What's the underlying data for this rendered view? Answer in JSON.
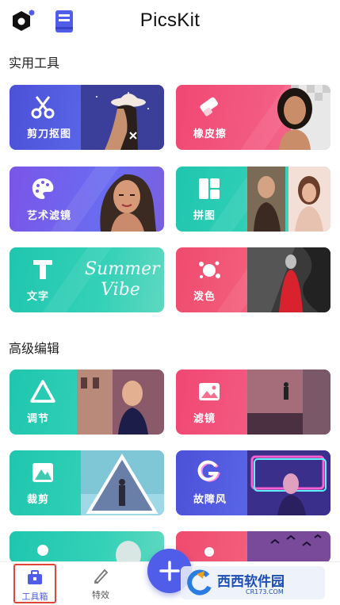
{
  "app": {
    "title": "PicsKit"
  },
  "header": {
    "settings_icon": "settings-hex-icon",
    "guide_icon": "book-icon"
  },
  "sections": [
    {
      "title": "实用工具"
    },
    {
      "title": "高级编辑"
    }
  ],
  "tools": [
    {
      "label": "剪刀抠图",
      "icon": "scissors-icon"
    },
    {
      "label": "橡皮擦",
      "icon": "eraser-icon"
    },
    {
      "label": "艺术滤镜",
      "icon": "palette-icon"
    },
    {
      "label": "拼图",
      "icon": "collage-icon"
    },
    {
      "label": "文字",
      "icon": "text-icon"
    },
    {
      "label": "泼色",
      "icon": "splash-icon"
    }
  ],
  "tools_image_text": {
    "text_card": "Summer Vibe"
  },
  "advanced": [
    {
      "label": "调节",
      "icon": "adjust-triangle-icon"
    },
    {
      "label": "滤镜",
      "icon": "filter-image-icon"
    },
    {
      "label": "裁剪",
      "icon": "crop-mountain-icon"
    },
    {
      "label": "故障风",
      "icon": "glitch-g-icon"
    },
    {
      "label": "",
      "icon": "portrait-icon"
    },
    {
      "label": "",
      "icon": "birds-icon"
    }
  ],
  "bottom_nav": [
    {
      "label": "工具箱",
      "icon": "toolbox-icon",
      "active": true
    },
    {
      "label": "特效",
      "icon": "effects-icon",
      "active": false
    }
  ],
  "fab": {
    "icon": "plus-icon"
  },
  "watermark": {
    "text": "西西软件园",
    "sub": "CR173.COM"
  },
  "colors": {
    "accent": "#4f5de8",
    "active_outline": "#e0453a"
  }
}
